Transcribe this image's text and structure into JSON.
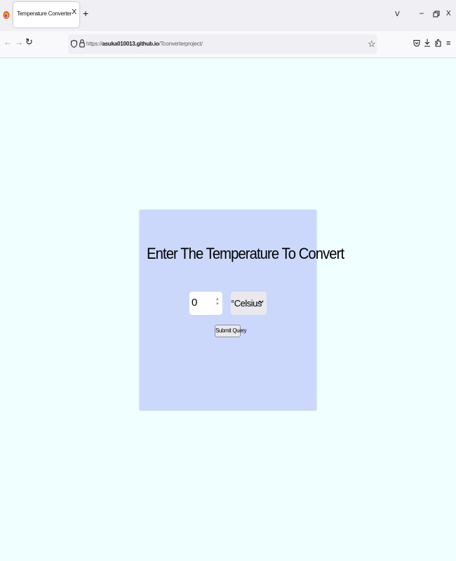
{
  "browser": {
    "tab_title": "Temperature Converter",
    "tab_close": "X",
    "new_tab": "+",
    "tab_list": "V",
    "minimize": "–",
    "close_window": "X",
    "url_scheme": "https://",
    "url_host": "asuka010013.github.io",
    "url_path": "/Tconverterproject/",
    "menu": "≡"
  },
  "page": {
    "background": "#f0ffff",
    "card_color": "#ccd8fb",
    "title": "Enter The Temperature To Convert",
    "temperature_value": "0",
    "unit_selected": "°Celsius",
    "submit_label": "Submit Query"
  }
}
